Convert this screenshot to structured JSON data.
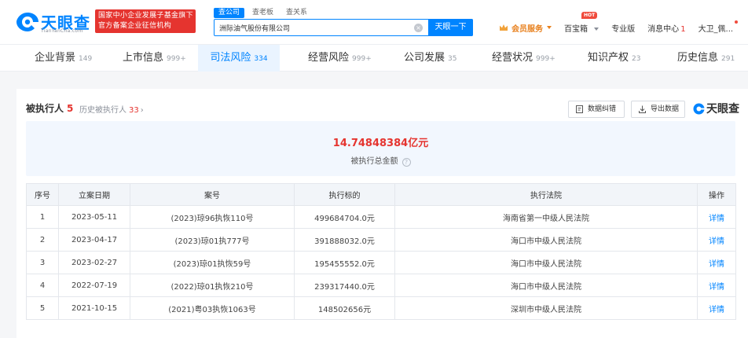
{
  "header": {
    "logo_text": "天眼查",
    "logo_sub": "TianYanCha.com",
    "banner_line1": "国家中小企业发展子基金旗下",
    "banner_line2": "官方备案企业征信机构",
    "search_tabs": [
      "查公司",
      "查老板",
      "查关系"
    ],
    "search_value": "洲际油气股份有限公司",
    "search_button": "天眼一下",
    "vip_label": "会员服务",
    "nav": [
      "百宝箱",
      "专业版",
      "消息中心"
    ],
    "hot_badge": "HOT",
    "message_count": "1",
    "user_name": "大卫_佩..."
  },
  "tabs": [
    {
      "label": "企业背景",
      "count": "149"
    },
    {
      "label": "上市信息",
      "count": "999+"
    },
    {
      "label": "司法风险",
      "count": "334"
    },
    {
      "label": "经营风险",
      "count": "999+"
    },
    {
      "label": "公司发展",
      "count": "35"
    },
    {
      "label": "经营状况",
      "count": "999+"
    },
    {
      "label": "知识产权",
      "count": "23"
    },
    {
      "label": "历史信息",
      "count": "291"
    }
  ],
  "section": {
    "title": "被执行人",
    "count": "5",
    "history_label": "历史被执行人",
    "history_count": "33",
    "chevron": "›",
    "btn_correct": "数据纠错",
    "btn_export": "导出数据",
    "brand": "天眼查"
  },
  "summary": {
    "amount": "14.74848384亿元",
    "label": "被执行总金额",
    "help_icon": "?"
  },
  "table": {
    "headers": [
      "序号",
      "立案日期",
      "案号",
      "执行标的",
      "执行法院",
      "操作"
    ],
    "rows": [
      [
        "1",
        "2023-05-11",
        "(2023)琼96执恢110号",
        "499684704.0元",
        "海南省第一中级人民法院",
        "详情"
      ],
      [
        "2",
        "2023-04-17",
        "(2023)琼01执777号",
        "391888032.0元",
        "海口市中级人民法院",
        "详情"
      ],
      [
        "3",
        "2023-02-27",
        "(2023)琼01执恢59号",
        "195455552.0元",
        "海口市中级人民法院",
        "详情"
      ],
      [
        "4",
        "2022-07-19",
        "(2022)琼01执恢210号",
        "239317440.0元",
        "海口市中级人民法院",
        "详情"
      ],
      [
        "5",
        "2021-10-15",
        "(2021)粤03执恢1063号",
        "148502656元",
        "深圳市中级人民法院",
        "详情"
      ]
    ]
  },
  "colors": {
    "brand": "#0084ff",
    "accent_red": "#e5342f",
    "vip": "#e8801d"
  }
}
